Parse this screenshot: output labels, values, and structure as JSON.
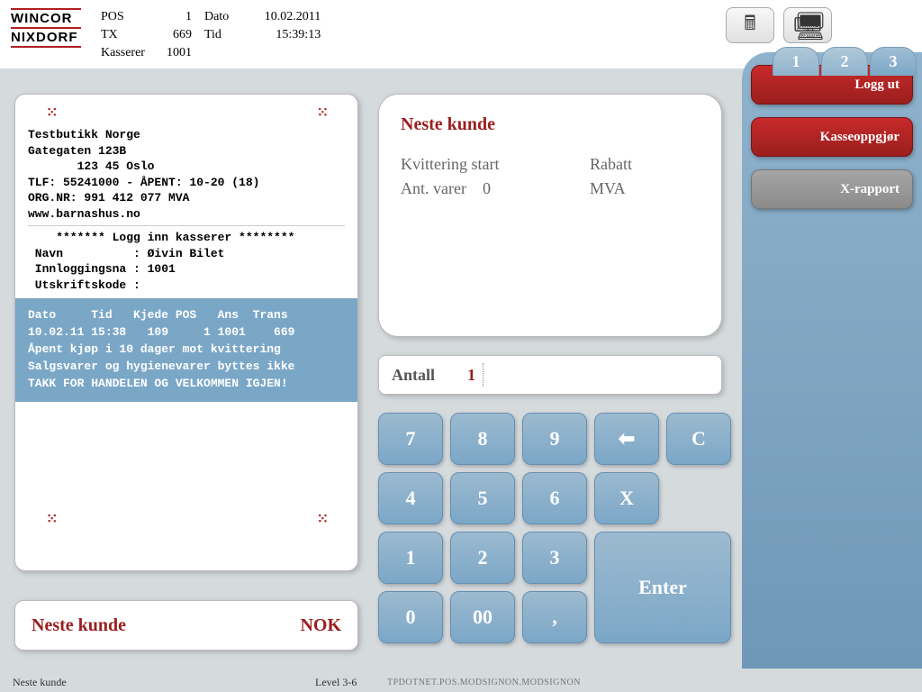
{
  "logo": {
    "line1": "WINCOR",
    "line2": "NIXDORF"
  },
  "header": {
    "pos_label": "POS",
    "pos_value": "1",
    "dato_label": "Dato",
    "dato_value": "10.02.2011",
    "tx_label": "TX",
    "tx_value": "669",
    "tid_label": "Tid",
    "tid_value": "15:39:13",
    "kasserer_label": "Kasserer",
    "kasserer_value": "1001"
  },
  "receipt": {
    "store_name": "Testbutikk Norge",
    "addr1": "Gategaten 123B",
    "addr2": "       123 45 Oslo",
    "tlf": "TLF: 55241000 - ÅPENT: 10-20 (18)",
    "org": "ORG.NR: 991 412 077 MVA",
    "web": "www.barnashus.no",
    "login_title": "    ******* Logg inn kasserer ********",
    "navn_line": " Navn          : Øivin Bilet",
    "innlogg_line": " Innloggingsna : 1001",
    "utskrift_line": " Utskriftskode :",
    "footer_hdr": "Dato     Tid   Kjede POS   Ans  Trans",
    "footer_vals": "10.02.11 15:38   109     1 1001    669",
    "policy1": "Åpent kjøp i 10 dager mot kvittering",
    "policy2": "Salgsvarer og hygienevarer byttes ikke",
    "policy3": "TAKK FOR HANDELEN OG VELKOMMEN IGJEN!"
  },
  "nc_bar": {
    "left": "Neste kunde",
    "right": "NOK"
  },
  "status": {
    "title": "Neste kunde",
    "kvitt_label": "Kvittering start",
    "rabatt_label": "Rabatt",
    "ant_label": "Ant. varer",
    "ant_value": "0",
    "mva_label": "MVA"
  },
  "antall": {
    "label": "Antall",
    "value": "1"
  },
  "keypad": {
    "k7": "7",
    "k8": "8",
    "k9": "9",
    "back": "⬅",
    "clear": "C",
    "k4": "4",
    "k5": "5",
    "k6": "6",
    "x": "X",
    "k1": "1",
    "k2": "2",
    "k3": "3",
    "k0": "0",
    "k00": "00",
    "comma": ",",
    "enter": "Enter"
  },
  "tabs": {
    "t1": "1",
    "t2": "2",
    "t3": "3"
  },
  "sidebar": {
    "loggut": "Logg ut",
    "kasse": "Kasseoppgjør",
    "xrapport": "X-rapport"
  },
  "footer": {
    "left": "Neste kunde",
    "level": "Level 3-6",
    "module": "TPDOTNET.POS.MODSIGNON.MODSIGNON"
  }
}
